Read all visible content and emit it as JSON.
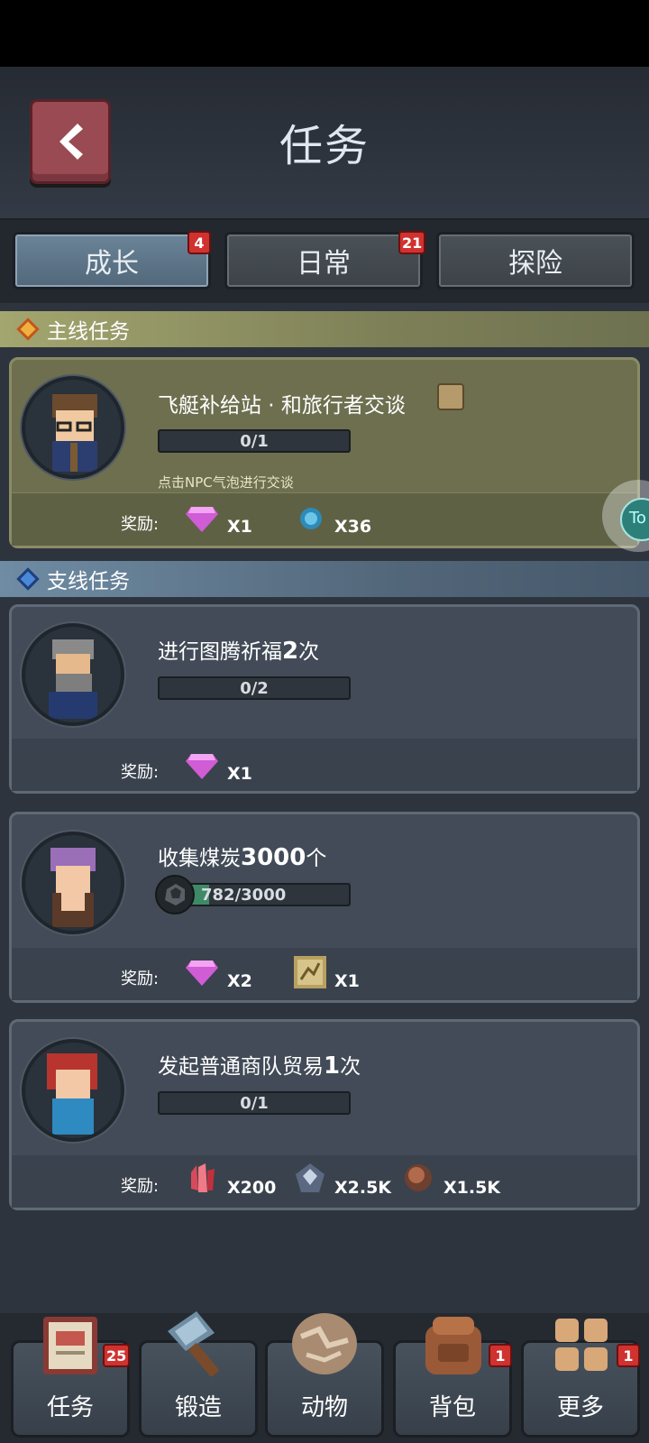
{
  "header": {
    "title": "任务",
    "back_icon": "chevron-left-icon"
  },
  "tabs": [
    {
      "label": "成长",
      "badge": "4",
      "active": true
    },
    {
      "label": "日常",
      "badge": "21",
      "active": false
    },
    {
      "label": "探险",
      "badge": "",
      "active": false
    }
  ],
  "main_section": {
    "title": "主线任务"
  },
  "side_section": {
    "title": "支线任务"
  },
  "reward_label": "奖励:",
  "quests": [
    {
      "title": "飞艇补给站 · 和旅行者交谈",
      "progress": "0/1",
      "hint": "点击NPC气泡进行交谈",
      "rewards": [
        {
          "icon": "pink-gem-icon",
          "qty": "X1"
        },
        {
          "icon": "exp-orb-icon",
          "qty": "X36"
        }
      ]
    },
    {
      "title_pre": "进行图腾祈福",
      "title_num": "2",
      "title_post": "次",
      "progress": "0/2",
      "rewards": [
        {
          "icon": "pink-gem-icon",
          "qty": "X1"
        }
      ]
    },
    {
      "title_pre": "收集煤炭",
      "title_num": "3000",
      "title_post": "个",
      "progress": "782/3000",
      "progress_fraction": 0.26,
      "rewards": [
        {
          "icon": "pink-gem-icon",
          "qty": "X2"
        },
        {
          "icon": "map-scroll-icon",
          "qty": "X1"
        }
      ]
    },
    {
      "title_pre": "发起普通商队贸易",
      "title_num": "1",
      "title_post": "次",
      "progress": "0/1",
      "rewards": [
        {
          "icon": "red-crystal-icon",
          "qty": "X200"
        },
        {
          "icon": "iron-ore-icon",
          "qty": "X2.5K"
        },
        {
          "icon": "copper-ore-icon",
          "qty": "X1.5K"
        }
      ]
    }
  ],
  "nav": [
    {
      "label": "任务",
      "badge": "25",
      "icon": "quest-book-icon"
    },
    {
      "label": "锻造",
      "badge": "",
      "icon": "hammer-icon"
    },
    {
      "label": "动物",
      "badge": "",
      "icon": "egg-icon"
    },
    {
      "label": "背包",
      "badge": "1",
      "icon": "backpack-icon"
    },
    {
      "label": "更多",
      "badge": "1",
      "icon": "grid-icon"
    }
  ],
  "floating_button": {
    "text": "To"
  }
}
